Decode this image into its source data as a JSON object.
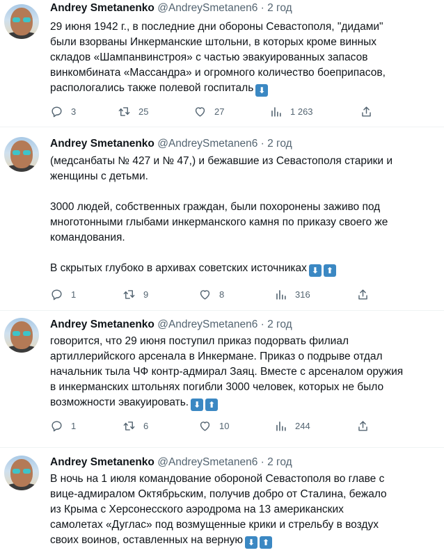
{
  "tweets": [
    {
      "author": "Andrey Smetanenko",
      "handle": "@AndreySmetanen6",
      "separator": "·",
      "time": "2 год",
      "lines": [
        "29 июня 1942 г., в последние дни обороны Севастополя, \"дидами\"",
        "были взорваны Инкерманские штольни, в которых кроме винных",
        "складов «Шампанвинстроя» с частью эвакуированных запасов",
        "винкомбината «Массандра» и огромного количество боеприпасов,",
        "распологались также полевой госпиталь"
      ],
      "emojis": [
        "⬇"
      ],
      "replies": "3",
      "retweets": "25",
      "likes": "27",
      "views": "1 263"
    },
    {
      "author": "Andrey Smetanenko",
      "handle": "@AndreySmetanen6",
      "separator": "·",
      "time": "2 год",
      "lines": [
        "(медсанбаты № 427 и № 47,) и бежавшие из Севастополя старики и",
        "женщины с детьми.",
        "",
        "3000 людей, собственных граждан, были похоронены заживо под",
        "многотонными глыбами инкерманского камня по приказу своего же",
        "командования.",
        "",
        "В скрытых глубоко в архивах советских источниках"
      ],
      "emojis": [
        "⬇",
        "⬆"
      ],
      "replies": "1",
      "retweets": "9",
      "likes": "8",
      "views": "316"
    },
    {
      "author": "Andrey Smetanenko",
      "handle": "@AndreySmetanen6",
      "separator": "·",
      "time": "2 год",
      "lines": [
        "говорится, что 29 июня поступил приказ подорвать филиал",
        "артиллерийского арсенала в Инкермане. Приказ о подрыве отдал",
        "начальник тыла ЧФ контр-адмирал Заяц. Вместе с арсеналом оружия",
        "в инкерманских штольнях погибли 3000 человек, которых не было",
        "возможности эвакуировать."
      ],
      "emojis": [
        "⬇",
        "⬆"
      ],
      "replies": "1",
      "retweets": "6",
      "likes": "10",
      "views": "244"
    },
    {
      "author": "Andrey Smetanenko",
      "handle": "@AndreySmetanen6",
      "separator": "·",
      "time": "2 год",
      "lines": [
        "В ночь на 1 июля командование обороной Севастополя во главе с",
        "вице-адмиралом Октябрьским, получив добро от Сталина, бежало",
        "из Крыма с Херсонесского аэродрома на 13  американских",
        "самолетах «Дуглас» под возмущенные крики и стрельбу в воздух",
        "своих воинов, оставленных на верную"
      ],
      "emojis": [
        "⬇",
        "⬆"
      ]
    }
  ],
  "colors": {
    "text": "#0f1419",
    "muted": "#536471",
    "divider": "#eff3f4",
    "emoji_bg": "#3b88c3"
  },
  "icons": {
    "reply": "reply-icon",
    "retweet": "retweet-icon",
    "like": "heart-icon",
    "views": "views-icon",
    "share": "share-icon"
  }
}
